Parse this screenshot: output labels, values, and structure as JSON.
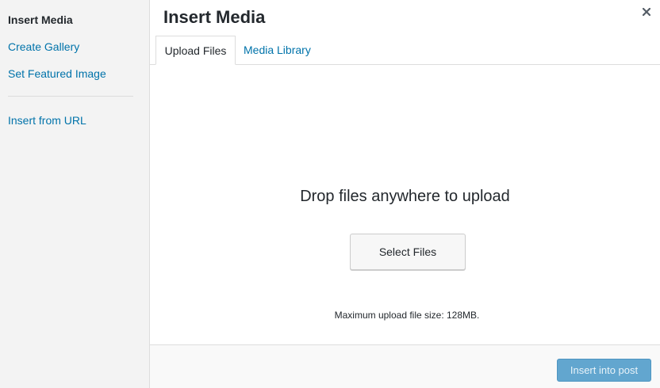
{
  "sidebar": {
    "items": [
      {
        "label": "Insert Media",
        "active": true
      },
      {
        "label": "Create Gallery",
        "active": false
      },
      {
        "label": "Set Featured Image",
        "active": false
      },
      {
        "label": "Insert from URL",
        "active": false
      }
    ]
  },
  "header": {
    "title": "Insert Media",
    "close_icon": "close-icon"
  },
  "tabs": [
    {
      "label": "Upload Files",
      "active": true
    },
    {
      "label": "Media Library",
      "active": false
    }
  ],
  "uploader": {
    "drop_text": "Drop files anywhere to upload",
    "select_button_label": "Select Files",
    "max_size_text": "Maximum upload file size: 128MB."
  },
  "toolbar": {
    "insert_button_label": "Insert into post",
    "insert_button_disabled": true
  },
  "colors": {
    "link": "#0073aa",
    "sidebar_bg": "#f3f3f3",
    "primary_disabled": "#62a6cf"
  }
}
